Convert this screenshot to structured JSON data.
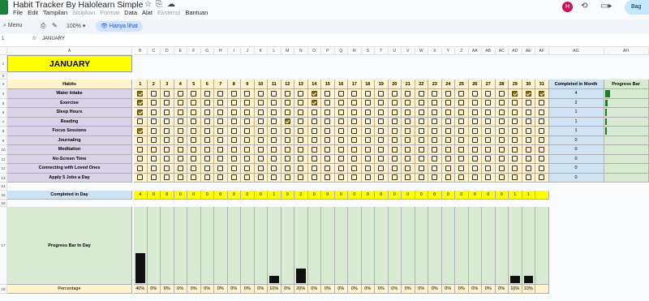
{
  "doc": {
    "title": "Habit Tracker By Halolearn Simple"
  },
  "menu": [
    {
      "label": "File",
      "enabled": true
    },
    {
      "label": "Edit",
      "enabled": true
    },
    {
      "label": "Tampilan",
      "enabled": true
    },
    {
      "label": "Sisipkan",
      "enabled": false
    },
    {
      "label": "Format",
      "enabled": false
    },
    {
      "label": "Data",
      "enabled": true
    },
    {
      "label": "Alat",
      "enabled": true
    },
    {
      "label": "Ekstensi",
      "enabled": false
    },
    {
      "label": "Bantuan",
      "enabled": true
    }
  ],
  "header": {
    "avatar": "H",
    "share_label": "Bag"
  },
  "toolbar": {
    "menu_label": "Menu",
    "zoom": "100%",
    "view_only": "Hanya lihat"
  },
  "formula_bar": {
    "cell_ref": "1",
    "value": "JANUARY"
  },
  "sheet": {
    "month": "JANUARY",
    "col_letter_a": "A",
    "day_col_letters": [
      "B",
      "C",
      "D",
      "E",
      "F",
      "G",
      "H",
      "I",
      "J",
      "K",
      "L",
      "M",
      "N",
      "O",
      "P",
      "Q",
      "R",
      "S",
      "T",
      "U",
      "V",
      "W",
      "X",
      "Y",
      "Z",
      "AA",
      "AB",
      "AC",
      "AD",
      "AE",
      "AF"
    ],
    "extra_col_letters": [
      "AG",
      "AH"
    ],
    "habits_header": "Habits",
    "completed_month_header": "Completed in Month",
    "progress_bar_header": "Progress Bar",
    "days": [
      "1",
      "2",
      "3",
      "4",
      "5",
      "6",
      "7",
      "8",
      "9",
      "10",
      "11",
      "12",
      "13",
      "14",
      "15",
      "16",
      "17",
      "18",
      "19",
      "20",
      "21",
      "22",
      "23",
      "24",
      "25",
      "26",
      "27",
      "28",
      "29",
      "30",
      "31"
    ],
    "habits": [
      {
        "name": "Water Intake",
        "checks": [
          1,
          0,
          0,
          0,
          0,
          0,
          0,
          0,
          0,
          0,
          0,
          0,
          0,
          1,
          0,
          0,
          0,
          0,
          0,
          0,
          0,
          0,
          0,
          0,
          0,
          0,
          0,
          0,
          1,
          1,
          1
        ],
        "completed": "4",
        "progress": 0.13
      },
      {
        "name": "Exercise",
        "checks": [
          1,
          0,
          0,
          0,
          0,
          0,
          0,
          0,
          0,
          0,
          0,
          0,
          0,
          1,
          0,
          0,
          0,
          0,
          0,
          0,
          0,
          0,
          0,
          0,
          0,
          0,
          0,
          0,
          0,
          0,
          0
        ],
        "completed": "2",
        "progress": 0.06
      },
      {
        "name": "Sleep Hours",
        "checks": [
          1,
          0,
          0,
          0,
          0,
          0,
          0,
          0,
          0,
          0,
          0,
          0,
          0,
          0,
          0,
          0,
          0,
          0,
          0,
          0,
          0,
          0,
          0,
          0,
          0,
          0,
          0,
          0,
          0,
          0,
          0
        ],
        "completed": "1",
        "progress": 0.03
      },
      {
        "name": "Reading",
        "checks": [
          0,
          0,
          0,
          0,
          0,
          0,
          0,
          0,
          0,
          0,
          0,
          1,
          0,
          0,
          0,
          0,
          0,
          0,
          0,
          0,
          0,
          0,
          0,
          0,
          0,
          0,
          0,
          0,
          0,
          0,
          0
        ],
        "completed": "1",
        "progress": 0.03
      },
      {
        "name": "Focus Sessions",
        "checks": [
          1,
          0,
          0,
          0,
          0,
          0,
          0,
          0,
          0,
          0,
          0,
          0,
          0,
          0,
          0,
          0,
          0,
          0,
          0,
          0,
          0,
          0,
          0,
          0,
          0,
          0,
          0,
          0,
          0,
          0,
          0
        ],
        "completed": "1",
        "progress": 0.03
      },
      {
        "name": "Journaling",
        "checks": [
          0,
          0,
          0,
          0,
          0,
          0,
          0,
          0,
          0,
          0,
          0,
          0,
          0,
          0,
          0,
          0,
          0,
          0,
          0,
          0,
          0,
          0,
          0,
          0,
          0,
          0,
          0,
          0,
          0,
          0,
          0
        ],
        "completed": "0",
        "progress": 0
      },
      {
        "name": "Meditation",
        "checks": [
          0,
          0,
          0,
          0,
          0,
          0,
          0,
          0,
          0,
          0,
          0,
          0,
          0,
          0,
          0,
          0,
          0,
          0,
          0,
          0,
          0,
          0,
          0,
          0,
          0,
          0,
          0,
          0,
          0,
          0,
          0
        ],
        "completed": "0",
        "progress": 0
      },
      {
        "name": "No-Screen Time",
        "checks": [
          0,
          0,
          0,
          0,
          0,
          0,
          0,
          0,
          0,
          0,
          0,
          0,
          0,
          0,
          0,
          0,
          0,
          0,
          0,
          0,
          0,
          0,
          0,
          0,
          0,
          0,
          0,
          0,
          0,
          0,
          0
        ],
        "completed": "0",
        "progress": 0
      },
      {
        "name": "Connecting with Loved Ones",
        "checks": [
          0,
          0,
          0,
          0,
          0,
          0,
          0,
          0,
          0,
          0,
          0,
          0,
          0,
          0,
          0,
          0,
          0,
          0,
          0,
          0,
          0,
          0,
          0,
          0,
          0,
          0,
          0,
          0,
          0,
          0,
          0
        ],
        "completed": "0",
        "progress": 0
      },
      {
        "name": "Apply 5 Jobs a Day",
        "checks": [
          0,
          0,
          0,
          0,
          0,
          0,
          0,
          0,
          0,
          0,
          0,
          0,
          0,
          0,
          0,
          0,
          0,
          0,
          0,
          0,
          0,
          0,
          0,
          0,
          0,
          0,
          0,
          0,
          0,
          0,
          0
        ],
        "completed": "0",
        "progress": 0
      }
    ],
    "completed_in_day_label": "Completed in Day",
    "completed_in_day": [
      "4",
      "0",
      "0",
      "0",
      "0",
      "0",
      "0",
      "0",
      "0",
      "0",
      "1",
      "0",
      "2",
      "0",
      "0",
      "0",
      "0",
      "0",
      "0",
      "0",
      "0",
      "0",
      "0",
      "0",
      "0",
      "0",
      "0",
      "0",
      "1",
      "1",
      ""
    ],
    "progress_bar_in_day_label": "Progress Bar In Day",
    "percentage_label": "Percentage",
    "percentages": [
      "40%",
      "0%",
      "0%",
      "0%",
      "0%",
      "0%",
      "0%",
      "0%",
      "0%",
      "0%",
      "10%",
      "0%",
      "20%",
      "0%",
      "0%",
      "0%",
      "0%",
      "0%",
      "0%",
      "0%",
      "0%",
      "0%",
      "0%",
      "0%",
      "0%",
      "0%",
      "0%",
      "0%",
      "10%",
      "10%",
      ""
    ],
    "day_progress": [
      0.4,
      0,
      0,
      0,
      0,
      0,
      0,
      0,
      0,
      0,
      0.1,
      0,
      0.2,
      0,
      0,
      0,
      0,
      0,
      0,
      0,
      0,
      0,
      0,
      0,
      0,
      0,
      0,
      0,
      0.1,
      0.1,
      0
    ],
    "row_numbers": [
      "1",
      "2",
      "3",
      "4",
      "5",
      "6",
      "7",
      "8",
      "9",
      "10",
      "11",
      "12",
      "13",
      "14",
      "15",
      "16",
      "17",
      "18"
    ],
    "colors": {
      "yellow": "#ffff00",
      "cream": "#fff2cc",
      "purple": "#d9d2e9",
      "blue": "#cfe2f3",
      "green": "#d9ead3",
      "check_on": "#8a6d0b"
    }
  }
}
